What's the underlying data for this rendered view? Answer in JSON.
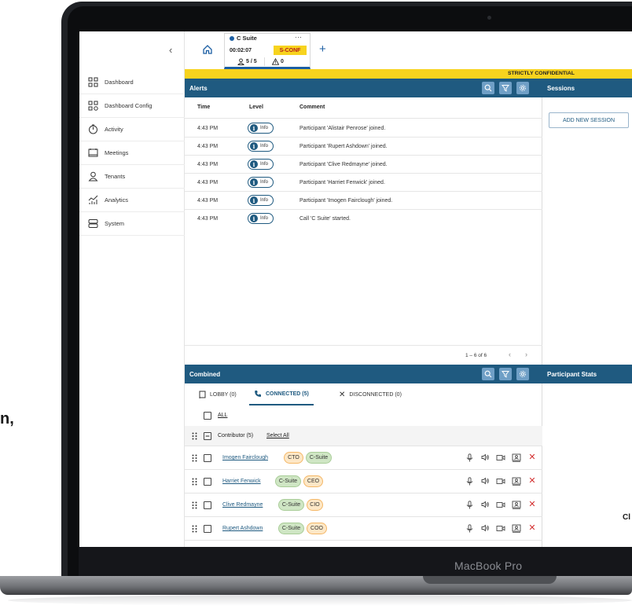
{
  "device": {
    "model": "MacBook Pro"
  },
  "side_text": {
    "left": "n,",
    "right": "Cl"
  },
  "sidebar": {
    "items": [
      {
        "label": "Dashboard",
        "icon": "dashboard-icon"
      },
      {
        "label": "Dashboard Config",
        "icon": "dashboard-config-icon"
      },
      {
        "label": "Activity",
        "icon": "activity-icon"
      },
      {
        "label": "Meetings",
        "icon": "meetings-icon"
      },
      {
        "label": "Tenants",
        "icon": "tenants-icon"
      },
      {
        "label": "Analytics",
        "icon": "analytics-icon"
      },
      {
        "label": "System",
        "icon": "system-icon"
      }
    ]
  },
  "call": {
    "name": "C Suite",
    "duration": "00:02:07",
    "classification": "S-CONF",
    "participants": "5 / 5",
    "warnings": "0"
  },
  "banner": {
    "text": "STRICTLY CONFIDENTIAL"
  },
  "alerts": {
    "title": "Alerts",
    "columns": [
      "Time",
      "Level",
      "Comment"
    ],
    "rows": [
      {
        "time": "4:43 PM",
        "level": "Info",
        "comment": "Participant 'Alistair Penrose' joined."
      },
      {
        "time": "4:43 PM",
        "level": "Info",
        "comment": "Participant 'Rupert Ashdown' joined."
      },
      {
        "time": "4:43 PM",
        "level": "Info",
        "comment": "Participant 'Clive Redmayne' joined."
      },
      {
        "time": "4:43 PM",
        "level": "Info",
        "comment": "Participant 'Harriet Fenwick' joined."
      },
      {
        "time": "4:43 PM",
        "level": "Info",
        "comment": "Participant 'Imogen Fairclough' joined."
      },
      {
        "time": "4:43 PM",
        "level": "Info",
        "comment": "Call 'C Suite' started."
      }
    ],
    "pagination": "1 – 6 of 6"
  },
  "sessions": {
    "title": "Sessions",
    "add_label": "ADD NEW SESSION"
  },
  "combined": {
    "title": "Combined",
    "tabs": [
      {
        "label": "LOBBY (0)",
        "icon": "lobby-icon"
      },
      {
        "label": "CONNECTED (5)",
        "icon": "phone-icon"
      },
      {
        "label": "DISCONNECTED (0)",
        "icon": "disconnected-icon"
      }
    ],
    "active_tab": "CONNECTED (5)",
    "all_label": "ALL",
    "group": {
      "label": "Contributor (5)",
      "select_all": "Select All"
    },
    "participants": [
      {
        "name": "Imogen Fairclough",
        "tags": [
          {
            "text": "CTO",
            "color": "orange"
          },
          {
            "text": "C-Suite",
            "color": "green"
          }
        ]
      },
      {
        "name": "Harriet Fenwick",
        "tags": [
          {
            "text": "C-Suite",
            "color": "green"
          },
          {
            "text": "CEO",
            "color": "orange"
          }
        ]
      },
      {
        "name": "Clive Redmayne",
        "tags": [
          {
            "text": "C-Suite",
            "color": "green"
          },
          {
            "text": "CIO",
            "color": "orange"
          }
        ]
      },
      {
        "name": "Rupert Ashdown",
        "tags": [
          {
            "text": "C-Suite",
            "color": "green"
          },
          {
            "text": "COO",
            "color": "orange"
          }
        ]
      }
    ]
  },
  "participant_stats": {
    "title": "Participant Stats"
  },
  "colors": {
    "header": "#1f5a80",
    "banner": "#f7d31e",
    "accent": "#1b5ea3",
    "remove": "#d32f2f"
  }
}
